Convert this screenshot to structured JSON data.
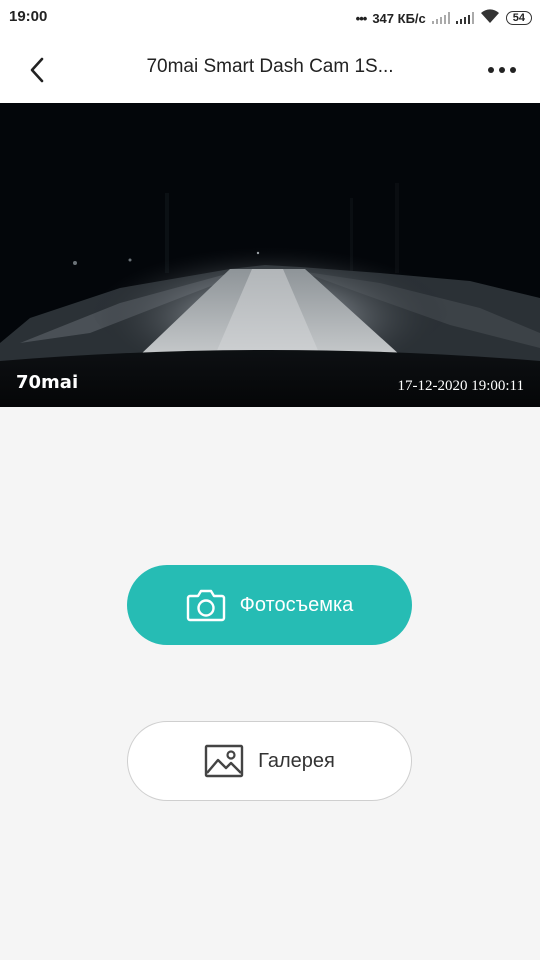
{
  "status_bar": {
    "time": "19:00",
    "speed": "347 КБ/с",
    "battery": "54"
  },
  "header": {
    "title": "70mai Smart Dash Cam 1S...",
    "back_icon": "chevron-left-icon",
    "more_icon": "more-dots-icon"
  },
  "preview": {
    "logo": "70mai",
    "timestamp": "17-12-2020 19:00:11"
  },
  "actions": {
    "photo_label": "Фотосъемка",
    "photo_icon": "camera-icon",
    "gallery_label": "Галерея",
    "gallery_icon": "image-icon"
  },
  "colors": {
    "accent": "#26bcb4",
    "background": "#f5f5f5"
  }
}
